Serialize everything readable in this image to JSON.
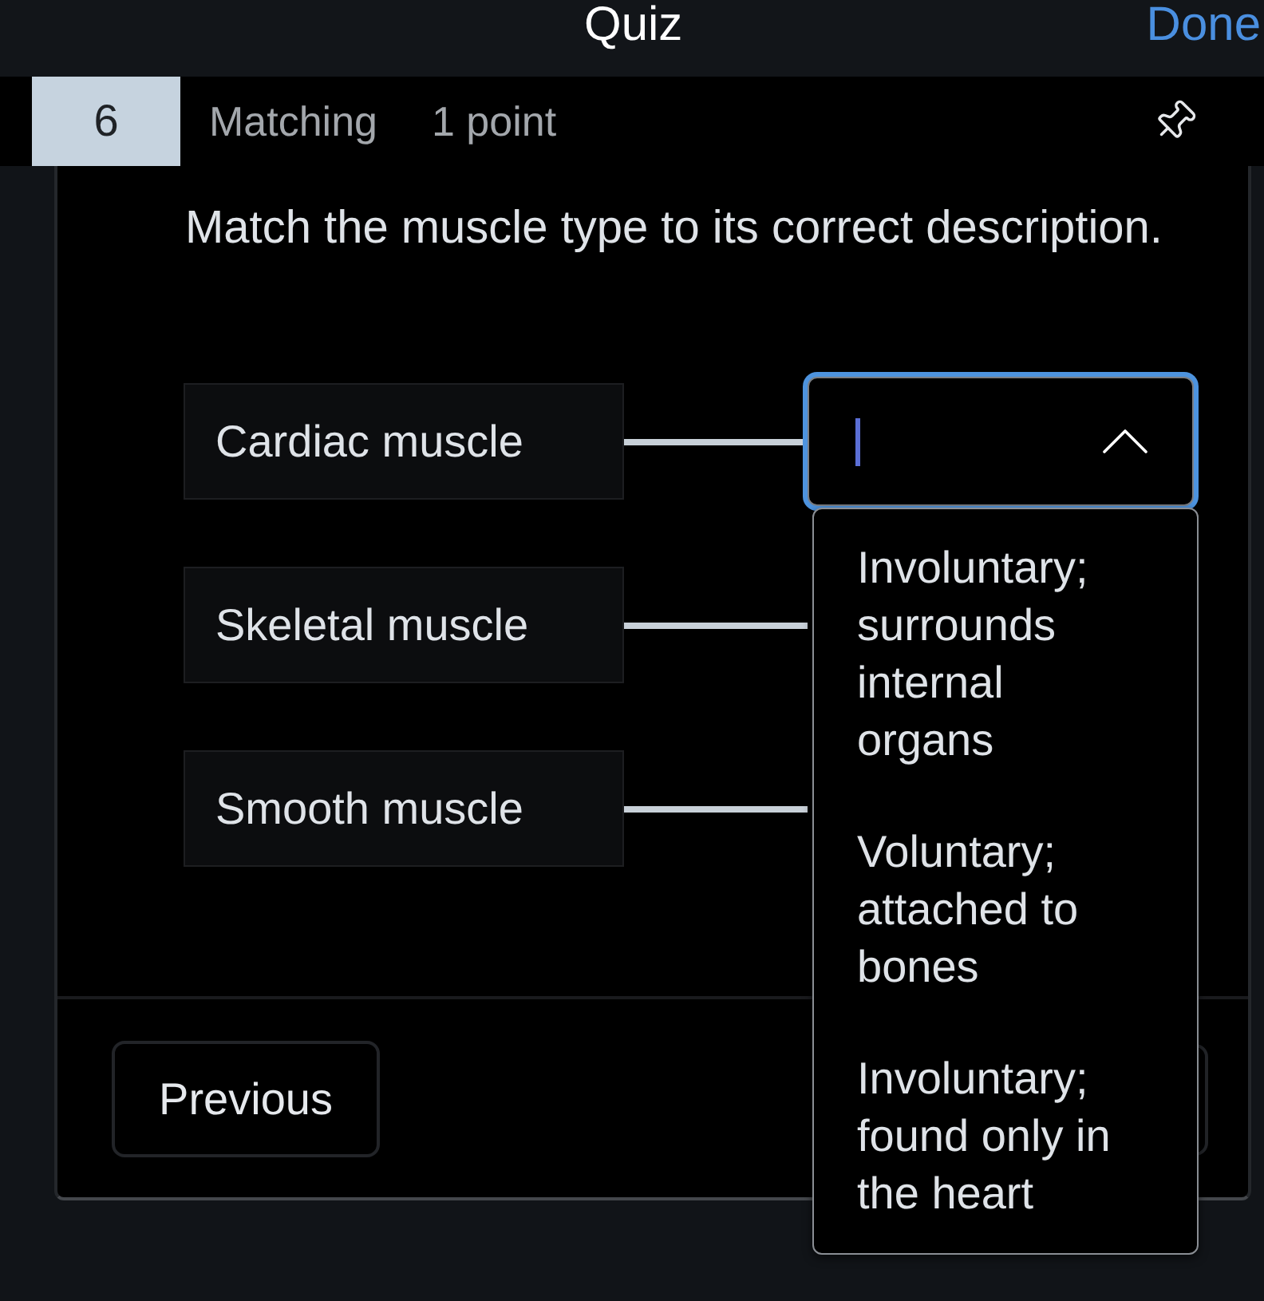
{
  "top_bar": {
    "title": "Quiz",
    "done_link": "Done"
  },
  "question": {
    "number": "6",
    "type": "Matching",
    "points": "1 point",
    "prompt": "Match the muscle type to its correct description."
  },
  "pairs": [
    {
      "term": "Cardiac muscle"
    },
    {
      "term": "Skeletal muscle"
    },
    {
      "term": "Smooth muscle"
    }
  ],
  "answer_dropdown": {
    "focused": true,
    "expanded": true,
    "options": [
      {
        "label": "Involuntary; surrounds internal organs",
        "selected": false
      },
      {
        "label": "Voluntary; attached to bones",
        "selected": false
      },
      {
        "label": "Involuntary; found only in the heart",
        "selected": false
      }
    ]
  },
  "footer": {
    "previous_button": "Previous"
  }
}
